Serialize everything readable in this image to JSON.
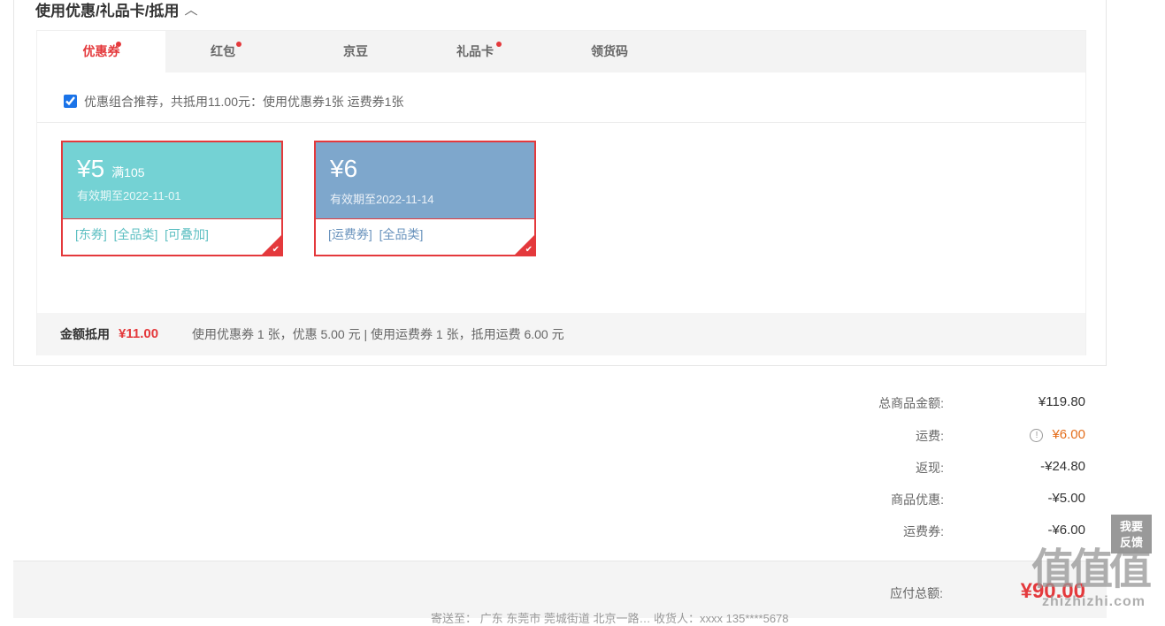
{
  "section": {
    "title": "使用优惠/礼品卡/抵用",
    "caret": "︿"
  },
  "tabs": [
    {
      "label": "优惠券",
      "dot": true,
      "active": true
    },
    {
      "label": "红包",
      "dot": true
    },
    {
      "label": "京豆",
      "dot": false
    },
    {
      "label": "礼品卡",
      "dot": true
    },
    {
      "label": "领货码",
      "dot": false
    }
  ],
  "combo": {
    "checked": true,
    "text": "优惠组合推荐，共抵用11.00元：使用优惠券1张 运费券1张"
  },
  "coupons": [
    {
      "amount": "¥5",
      "condition": "满105",
      "validity": "有效期至2022-11-01",
      "tags": [
        "[东券]",
        "[全品类]",
        "[可叠加]"
      ],
      "color": "#74d2d4",
      "tag_color": "#5cbfc2",
      "selected": true
    },
    {
      "amount": "¥6",
      "condition": "",
      "validity": "有效期至2022-11-14",
      "tags": [
        "[运费券]",
        "[全品类]"
      ],
      "color": "#7ea7cc",
      "tag_color": "#6a93bd",
      "selected": true
    }
  ],
  "summary": {
    "label": "金额抵用",
    "amount": "¥11.00",
    "desc": "使用优惠券 1 张，优惠 5.00 元  | 使用运费券 1 张，抵用运费 6.00 元"
  },
  "totals": [
    {
      "label": "总商品金额:",
      "value": "¥119.80"
    },
    {
      "label": "运费:",
      "value": "¥6.00",
      "icon": "info-icon",
      "highlight": "#e46e1b"
    },
    {
      "label": "返现:",
      "value": "-¥24.80"
    },
    {
      "label": "商品优惠:",
      "value": "-¥5.00"
    },
    {
      "label": "运费券:",
      "value": "-¥6.00"
    }
  ],
  "payable": {
    "label": "应付总额:",
    "amount": "¥90.00"
  },
  "address": "寄送至：  广东 东莞市 莞城街道 北京一路…  收货人：xxxx 135****5678",
  "feedback": {
    "line1": "我要",
    "line2": "反馈"
  },
  "watermark": {
    "big": "值值值",
    "small": "zhizhizhi.com"
  },
  "colors": {
    "accent": "#e4393c",
    "orange": "#e46e1b"
  }
}
